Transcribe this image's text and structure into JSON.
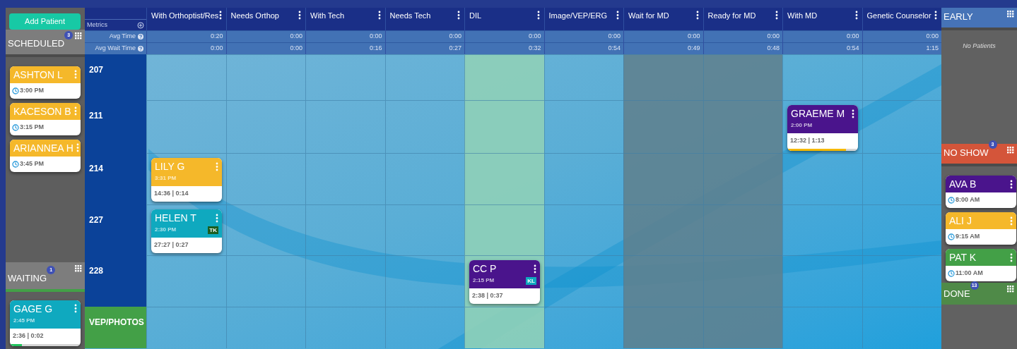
{
  "add_button": "Add Patient",
  "scheduled": {
    "title": "SCHEDULED",
    "count": "3",
    "patients": [
      {
        "name": "ASHTON L",
        "time": "3:00 PM",
        "color": "#f5b82a"
      },
      {
        "name": "KACESON B",
        "time": "3:15 PM",
        "color": "#f5b82a"
      },
      {
        "name": "ARIANNEA H",
        "time": "3:45 PM",
        "color": "#f5b82a"
      }
    ]
  },
  "waiting": {
    "title": "WAITING",
    "count": "1",
    "patients": [
      {
        "name": "GAGE G",
        "time": "2:45 PM",
        "color": "#0fa9bf",
        "times": "2:36 | 0:02",
        "progress": {
          "level": 0.17,
          "color": "#22c55e"
        }
      }
    ]
  },
  "metrics": {
    "title": "Metrics",
    "rows": [
      "Avg Time",
      "Avg Wait Time"
    ]
  },
  "columns": [
    {
      "title": "With Orthoptist/Res",
      "kind": "plain",
      "avg_time": "0:20",
      "avg_wait": "0:00"
    },
    {
      "title": "Needs Orthop",
      "kind": "plain",
      "avg_time": "0:00",
      "avg_wait": "0:00"
    },
    {
      "title": "With Tech",
      "kind": "plain",
      "avg_time": "0:00",
      "avg_wait": "0:16"
    },
    {
      "title": "Needs Tech",
      "kind": "plain",
      "avg_time": "0:00",
      "avg_wait": "0:27"
    },
    {
      "title": "DIL",
      "kind": "highlighted",
      "avg_time": "0:00",
      "avg_wait": "0:32"
    },
    {
      "title": "Image/VEP/ERG",
      "kind": "plain",
      "avg_time": "0:00",
      "avg_wait": "0:54"
    },
    {
      "title": "Wait for MD",
      "kind": "dimmed",
      "avg_time": "0:00",
      "avg_wait": "0:49"
    },
    {
      "title": "Ready for MD",
      "kind": "dimmed",
      "avg_time": "0:00",
      "avg_wait": "0:48"
    },
    {
      "title": "With MD",
      "kind": "plain",
      "avg_time": "0:00",
      "avg_wait": "0:54"
    },
    {
      "title": "Genetic Counselor",
      "kind": "plain",
      "avg_time": "0:00",
      "avg_wait": "1:15"
    }
  ],
  "rooms": [
    {
      "label": "207",
      "kind": "room",
      "cells": [
        null,
        null,
        null,
        null,
        null,
        null,
        null,
        null,
        null,
        null
      ]
    },
    {
      "label": "211",
      "kind": "room",
      "cells": [
        null,
        null,
        null,
        null,
        null,
        null,
        null,
        null,
        {
          "name": "GRAEME M",
          "time": "2:00 PM",
          "color": "#4a148c",
          "times": "12:32 | 1:13",
          "progress": {
            "level": 0.83,
            "color": "#f5b800"
          }
        },
        null
      ]
    },
    {
      "label": "214",
      "kind": "room",
      "cells": [
        {
          "name": "LILY G",
          "time": "3:31 PM",
          "color": "#f5b82a",
          "times": "14:36 | 0:14"
        },
        null,
        null,
        null,
        null,
        null,
        null,
        null,
        null,
        null
      ]
    },
    {
      "label": "227",
      "kind": "room",
      "cells": [
        {
          "name": "HELEN T",
          "time": "2:30 PM",
          "color": "#0fa9bf",
          "times": "27:27 | 0:27",
          "tag": {
            "text": "TK",
            "color": "#1b5e20"
          }
        },
        null,
        null,
        null,
        null,
        null,
        null,
        null,
        null,
        null
      ]
    },
    {
      "label": "228",
      "kind": "room",
      "cells": [
        null,
        null,
        null,
        null,
        {
          "name": "CC P",
          "time": "2:15 PM",
          "color": "#4a148c",
          "times": "2:38 | 0:37",
          "tag": {
            "text": "KL",
            "color": "#0fa9bf"
          }
        },
        null,
        null,
        null,
        null,
        null
      ]
    },
    {
      "label": "VEP/PHOTOS",
      "kind": "station",
      "cells": [
        null,
        null,
        null,
        null,
        null,
        null,
        null,
        null,
        null,
        null
      ]
    }
  ],
  "early": {
    "title": "EARLY",
    "empty_text": "No Patients"
  },
  "no_show": {
    "title": "NO SHOW",
    "count": "3",
    "patients": [
      {
        "name": "AVA B",
        "time": "8:00 AM",
        "color": "#4a148c"
      },
      {
        "name": "ALI J",
        "time": "9:15 AM",
        "color": "#f5b82a"
      },
      {
        "name": "PAT K",
        "time": "11:00 AM",
        "color": "#43a047"
      }
    ]
  },
  "done": {
    "title": "DONE",
    "count": "13"
  }
}
